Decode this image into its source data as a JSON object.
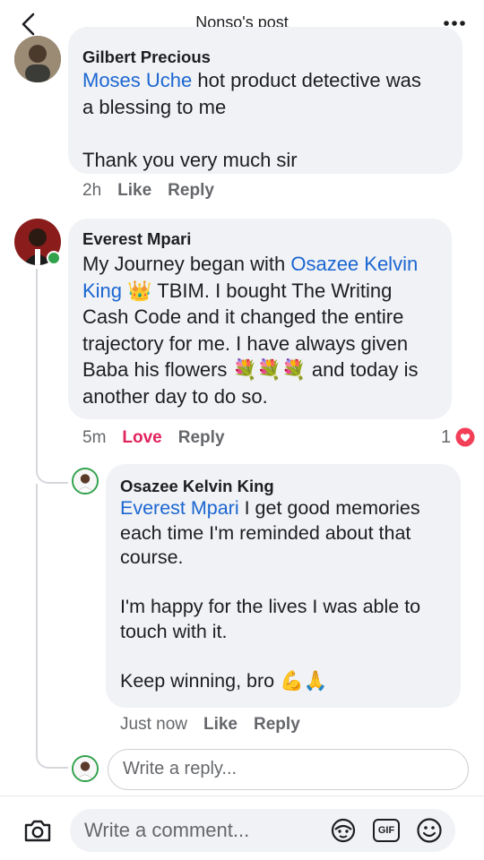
{
  "header": {
    "title": "Nonso's post"
  },
  "comments": [
    {
      "author": "Gilbert Precious",
      "mention": "Moses Uche",
      "text_after_mention": " hot product detective was\na blessing to me\n\nThank you very much sir",
      "time": "2h",
      "like_label": "Like",
      "reply_label": "Reply"
    },
    {
      "author": "Everest Mpari",
      "text_before_mention": "My Journey began with ",
      "mention": "Osazee Kelvin\nKing",
      "emoji_crown": "👑",
      "text_after_emoji": " TBIM. I bought The Writing\nCash Code and it changed the entire\ntrajectory for me. I have always given\nBaba his flowers ",
      "emoji_flowers": "💐💐💐",
      "text_end": " and today is\nanother day to do so.",
      "time": "5m",
      "reaction_label": "Love",
      "reply_label": "Reply",
      "reaction_count": "1"
    },
    {
      "author": "Osazee Kelvin King",
      "mention": "Everest Mpari",
      "text_after_mention": " I get good memories\neach time I'm reminded about that\ncourse.\n\nI'm happy for the lives I was able to\ntouch with it.\n\nKeep winning, bro ",
      "emoji_end": "💪🙏",
      "time": "Just now",
      "like_label": "Like",
      "reply_label": "Reply"
    }
  ],
  "reply_box": {
    "placeholder": "Write a reply..."
  },
  "composer": {
    "placeholder": "Write a comment...",
    "icons": [
      "camera-icon",
      "avatar-sticker-icon",
      "gif-icon",
      "emoji-icon"
    ],
    "gif_label": "GIF"
  },
  "colors": {
    "mention": "#1b66d2",
    "love": "#e0245e",
    "bubble": "#f0f2f5",
    "online": "#31a24c"
  }
}
